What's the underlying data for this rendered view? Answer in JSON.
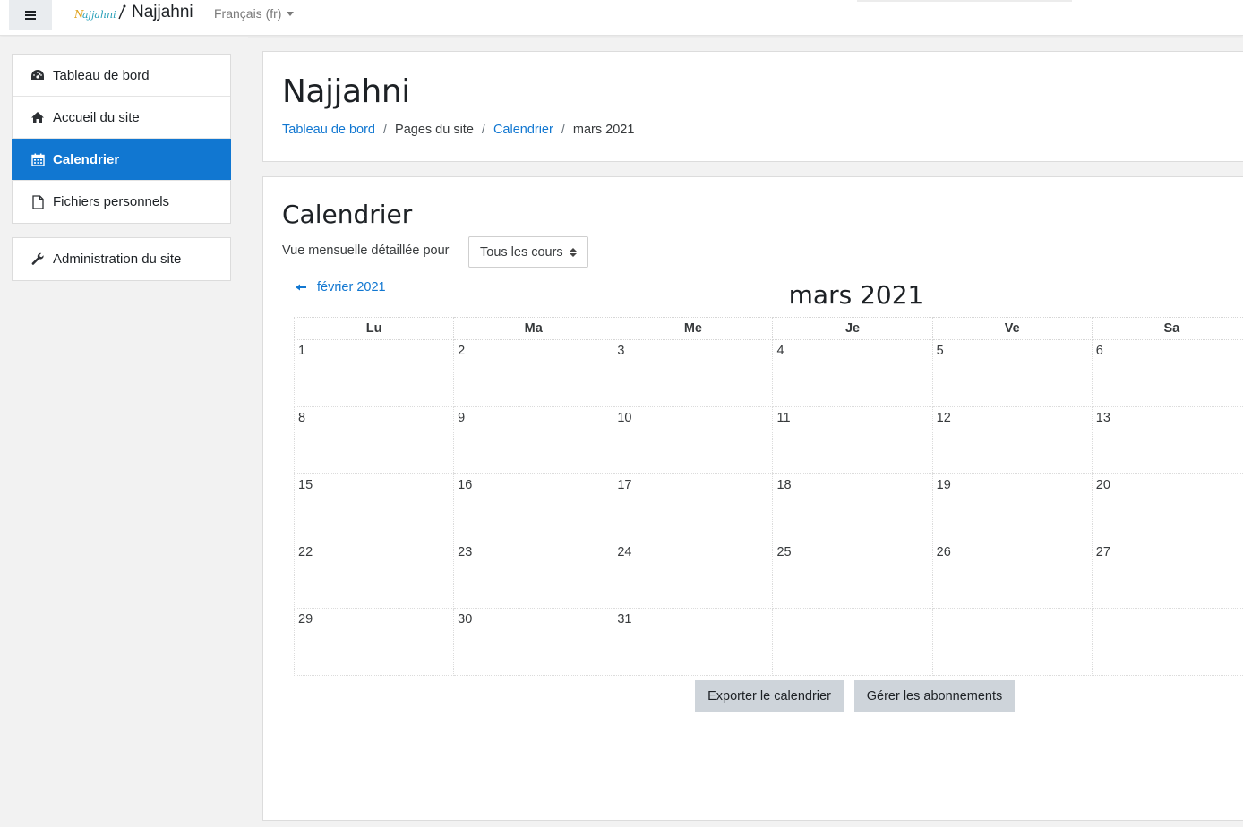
{
  "navbar": {
    "menu_icon": "hamburger-icon",
    "logo_text": "Najjahni",
    "site_name": "Najjahni",
    "language": "Français (fr)"
  },
  "nav": {
    "items": [
      {
        "label": "Tableau de bord",
        "icon": "dashboard-icon",
        "active": false
      },
      {
        "label": "Accueil du site",
        "icon": "home-icon",
        "active": false
      },
      {
        "label": "Calendrier",
        "icon": "calendar-icon",
        "active": true
      },
      {
        "label": "Fichiers personnels",
        "icon": "file-icon",
        "active": false
      }
    ],
    "admin": {
      "label": "Administration du site",
      "icon": "wrench-icon"
    }
  },
  "header": {
    "title": "Najjahni",
    "breadcrumb": {
      "b1": "Tableau de bord",
      "b2": "Pages du site",
      "b3": "Calendrier",
      "b4": "mars 2021",
      "separator": "/"
    }
  },
  "calendar": {
    "heading": "Calendrier",
    "filter_label": "Vue mensuelle détaillée pour",
    "course_select": "Tous les cours",
    "prev_month": "février 2021",
    "month_title": "mars 2021",
    "weekdays": [
      "Lu",
      "Ma",
      "Me",
      "Je",
      "Ve",
      "Sa"
    ],
    "weeks": [
      [
        "1",
        "2",
        "3",
        "4",
        "5",
        "6"
      ],
      [
        "8",
        "9",
        "10",
        "11",
        "12",
        "13"
      ],
      [
        "15",
        "16",
        "17",
        "18",
        "19",
        "20"
      ],
      [
        "22",
        "23",
        "24",
        "25",
        "26",
        "27"
      ],
      [
        "29",
        "30",
        "31",
        "",
        "",
        ""
      ]
    ],
    "export_button": "Exporter le calendrier",
    "manage_button": "Gérer les abonnements"
  },
  "colors": {
    "accent": "#1177d1",
    "button_bg": "#ced4da",
    "page_bg": "#f2f2f2"
  }
}
